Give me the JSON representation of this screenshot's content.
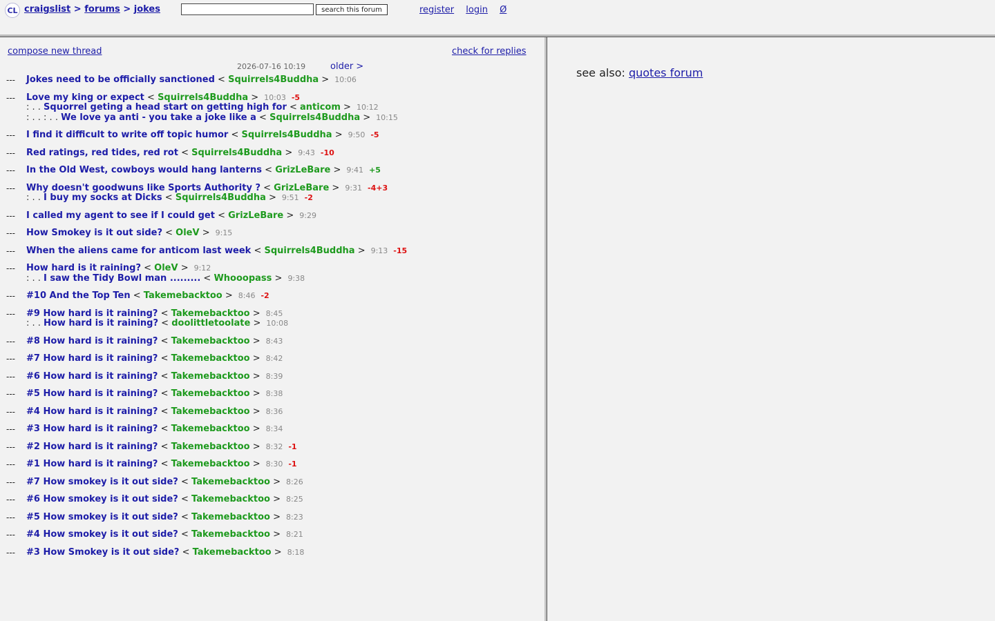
{
  "header": {
    "logo": "CL",
    "breadcrumb": [
      "craigslist",
      "forums",
      "jokes"
    ],
    "separator": ">",
    "search": {
      "value": "",
      "placeholder": "",
      "button_label": "search this forum"
    },
    "links": [
      "register",
      "login",
      "Ø"
    ]
  },
  "forum": {
    "compose_label": "compose new thread",
    "check_replies_label": "check for replies",
    "current_timestamp": "2026-07-16 10:19",
    "older_label": "older >",
    "threads": [
      {
        "lines": [
          {
            "prefix": "",
            "title": "Jokes need to be officially sanctioned",
            "author": "Squirrels4Buddha",
            "time": "10:06",
            "rating": ""
          }
        ]
      },
      {
        "lines": [
          {
            "prefix": "",
            "title": "Love my king or expect",
            "author": "Squirrels4Buddha",
            "time": "10:03",
            "rating": "-5"
          },
          {
            "prefix": ": . . ",
            "title": "Squorrel geting a head start on getting high for",
            "author": "anticom",
            "time": "10:12",
            "rating": ""
          },
          {
            "prefix": ": . . : . . ",
            "title": "We love ya anti - you take a joke like a",
            "author": "Squirrels4Buddha",
            "time": "10:15",
            "rating": ""
          }
        ]
      },
      {
        "lines": [
          {
            "prefix": "",
            "title": "I find it difficult to write off topic humor",
            "author": "Squirrels4Buddha",
            "time": "9:50",
            "rating": "-5"
          }
        ]
      },
      {
        "lines": [
          {
            "prefix": "",
            "title": "Red ratings, red tides, red rot",
            "author": "Squirrels4Buddha",
            "time": "9:43",
            "rating": "-10"
          }
        ]
      },
      {
        "lines": [
          {
            "prefix": "",
            "title": "In the Old West, cowboys would hang lanterns",
            "author": "GrizLeBare",
            "time": "9:41",
            "rating": "+5"
          }
        ]
      },
      {
        "lines": [
          {
            "prefix": "",
            "title": "Why doesn't goodwuns like Sports Authority ?",
            "author": "GrizLeBare",
            "time": "9:31",
            "rating": "-4+3"
          },
          {
            "prefix": ": . . ",
            "title": "I buy my socks at Dicks",
            "author": "Squirrels4Buddha",
            "time": "9:51",
            "rating": "-2"
          }
        ]
      },
      {
        "lines": [
          {
            "prefix": "",
            "title": "I called my agent to see if I could get",
            "author": "GrizLeBare",
            "time": "9:29",
            "rating": ""
          }
        ]
      },
      {
        "lines": [
          {
            "prefix": "",
            "title": "How Smokey is it out side?",
            "author": "OleV",
            "time": "9:15",
            "rating": ""
          }
        ]
      },
      {
        "lines": [
          {
            "prefix": "",
            "title": "When the aliens came for anticom last week",
            "author": "Squirrels4Buddha",
            "time": "9:13",
            "rating": "-15"
          }
        ]
      },
      {
        "lines": [
          {
            "prefix": "",
            "title": "How hard is it raining?",
            "author": "OleV",
            "time": "9:12",
            "rating": ""
          },
          {
            "prefix": ": . . ",
            "title": "I saw the Tidy Bowl man .........",
            "author": "Whooopass",
            "time": "9:38",
            "rating": ""
          }
        ]
      },
      {
        "lines": [
          {
            "prefix": "",
            "title": "#10 And the Top Ten",
            "author": "Takemebacktoo",
            "time": "8:46",
            "rating": "-2"
          }
        ]
      },
      {
        "lines": [
          {
            "prefix": "",
            "title": "#9 How hard is it raining?",
            "author": "Takemebacktoo",
            "time": "8:45",
            "rating": ""
          },
          {
            "prefix": ": . . ",
            "title": "How hard is it raining?",
            "author": "doolittletoolate",
            "time": "10:08",
            "rating": ""
          }
        ]
      },
      {
        "lines": [
          {
            "prefix": "",
            "title": "#8 How hard is it raining?",
            "author": "Takemebacktoo",
            "time": "8:43",
            "rating": ""
          }
        ]
      },
      {
        "lines": [
          {
            "prefix": "",
            "title": "#7 How hard is it raining?",
            "author": "Takemebacktoo",
            "time": "8:42",
            "rating": ""
          }
        ]
      },
      {
        "lines": [
          {
            "prefix": "",
            "title": "#6 How hard is it raining?",
            "author": "Takemebacktoo",
            "time": "8:39",
            "rating": ""
          }
        ]
      },
      {
        "lines": [
          {
            "prefix": "",
            "title": "#5 How hard is it raining?",
            "author": "Takemebacktoo",
            "time": "8:38",
            "rating": ""
          }
        ]
      },
      {
        "lines": [
          {
            "prefix": "",
            "title": "#4 How hard is it raining?",
            "author": "Takemebacktoo",
            "time": "8:36",
            "rating": ""
          }
        ]
      },
      {
        "lines": [
          {
            "prefix": "",
            "title": "#3 How hard is it raining?",
            "author": "Takemebacktoo",
            "time": "8:34",
            "rating": ""
          }
        ]
      },
      {
        "lines": [
          {
            "prefix": "",
            "title": "#2 How hard is it raining?",
            "author": "Takemebacktoo",
            "time": "8:32",
            "rating": "-1"
          }
        ]
      },
      {
        "lines": [
          {
            "prefix": "",
            "title": "#1 How hard is it raining?",
            "author": "Takemebacktoo",
            "time": "8:30",
            "rating": "-1"
          }
        ]
      },
      {
        "lines": [
          {
            "prefix": "",
            "title": "#7 How smokey is it out side?",
            "author": "Takemebacktoo",
            "time": "8:26",
            "rating": ""
          }
        ]
      },
      {
        "lines": [
          {
            "prefix": "",
            "title": "#6 How smokey is it out side?",
            "author": "Takemebacktoo",
            "time": "8:25",
            "rating": ""
          }
        ]
      },
      {
        "lines": [
          {
            "prefix": "",
            "title": "#5 How smokey is it out side?",
            "author": "Takemebacktoo",
            "time": "8:23",
            "rating": ""
          }
        ]
      },
      {
        "lines": [
          {
            "prefix": "",
            "title": "#4 How smokey is it out side?",
            "author": "Takemebacktoo",
            "time": "8:21",
            "rating": ""
          }
        ]
      },
      {
        "lines": [
          {
            "prefix": "",
            "title": "#3 How Smokey is it out side?",
            "author": "Takemebacktoo",
            "time": "8:18",
            "rating": ""
          }
        ]
      }
    ]
  },
  "sidebar": {
    "see_also_label": "see also:",
    "see_also_link": "quotes forum"
  },
  "colors": {
    "link": "#1d1da8",
    "author": "#1e9a1e",
    "negative_rating": "#dd1111",
    "positive_rating": "#1e9a1e",
    "background": "#f2f2f2"
  }
}
